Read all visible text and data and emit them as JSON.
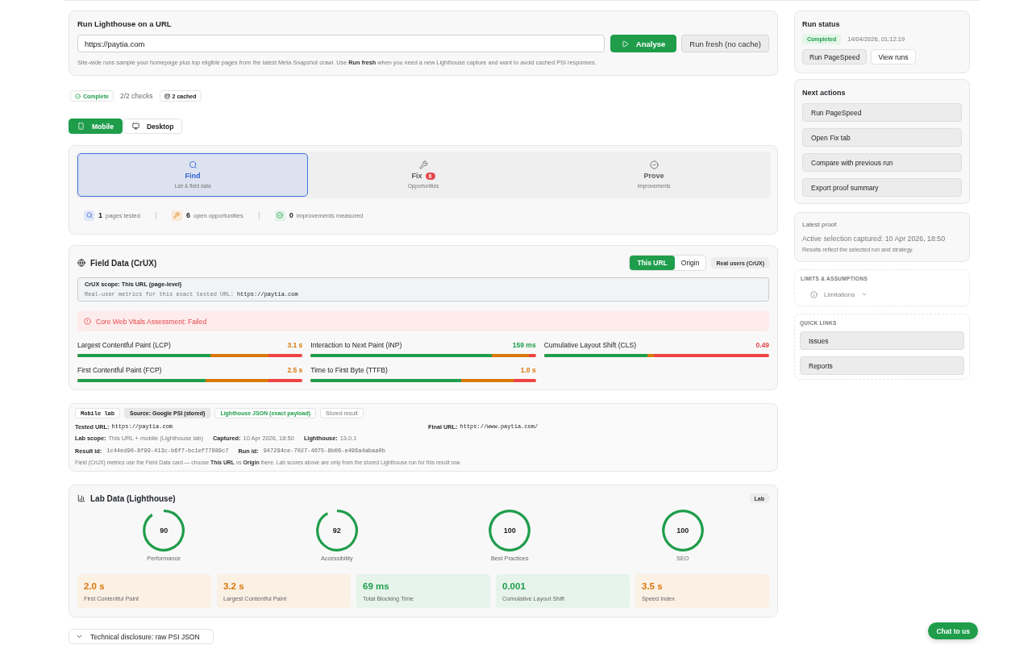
{
  "url_runner": {
    "title": "Run Lighthouse on a URL",
    "url_field": {
      "value": "https://paytia.com"
    },
    "buttons": [
      {
        "label": "Analyse",
        "kind": "primary"
      },
      {
        "label": "Run fresh (no cache)",
        "kind": "secondary"
      }
    ],
    "hint": "Site-wide runs sample your homepage plus top eligible pages from the latest Meta Snapshot crawl. Use **Run fresh** when you need a new Lighthouse capture and want to avoid cached PSI responses."
  },
  "status_chips": [
    {
      "kind": "complete",
      "label": "Complete"
    },
    {
      "kind": "plain",
      "label": "2/2 checks"
    },
    {
      "kind": "cached",
      "label": "2 cached"
    }
  ],
  "strategy_toggle": [
    {
      "label": "Mobile",
      "kind": "mobile",
      "selected": true
    },
    {
      "label": "Desktop",
      "kind": "desktop",
      "selected": false
    }
  ],
  "workflow": {
    "tabs": [
      {
        "kind": "find",
        "label": "Find",
        "sublabel": "Lab & field data",
        "selected": true
      },
      {
        "kind": "fix",
        "label": "Fix",
        "badge": "6",
        "sublabel": "Opportunities",
        "selected": false
      },
      {
        "kind": "prove",
        "label": "Prove",
        "sublabel": "Improvements",
        "selected": false
      }
    ],
    "stats": [
      {
        "kind": "find",
        "count": "1",
        "label": "pages tested"
      },
      {
        "kind": "fix",
        "count": "6",
        "label": "open opportunities"
      },
      {
        "kind": "prove",
        "count": "0",
        "label": "improvements measured"
      }
    ]
  },
  "field_data": {
    "title": "Field Data (CrUX)",
    "scope_toggle": [
      {
        "label": "This URL",
        "selected": true
      },
      {
        "label": "Origin",
        "selected": false
      }
    ],
    "badge": "Real users (CrUX)",
    "scope_note": {
      "title": "CrUX scope: This URL (page-level)",
      "text": "Real-user metrics for this exact tested URL:",
      "url": "https://paytia.com"
    },
    "assessment": "Core Web Vitals Assessment: Failed",
    "metrics": [
      {
        "name": "Largest Contentful Paint (LCP)",
        "value": "3.1 s",
        "color": "#d9780a",
        "fills": [
          {
            "color": "#1f9d4b",
            "level": 0.59
          },
          {
            "color": "#d9780a",
            "level": 0.85
          }
        ]
      },
      {
        "name": "Interaction to Next Paint (INP)",
        "value": "159 ms",
        "color": "#1f9d4b",
        "fills": [
          {
            "color": "#1f9d4b",
            "level": 0.805
          },
          {
            "color": "#d9780a",
            "level": 0.97
          }
        ]
      },
      {
        "name": "Cumulative Layout Shift (CLS)",
        "value": "0.49",
        "color": "#e5484d",
        "fills": [
          {
            "color": "#1f9d4b",
            "level": 0.459
          },
          {
            "color": "#d9780a",
            "level": 0.488
          }
        ]
      },
      {
        "name": "First Contentful Paint (FCP)",
        "value": "2.5 s",
        "color": "#d9780a",
        "fills": [
          {
            "color": "#1f9d4b",
            "level": 0.568
          },
          {
            "color": "#d9780a",
            "level": 0.85
          }
        ]
      },
      {
        "name": "Time to First Byte (TTFB)",
        "value": "1.0 s",
        "color": "#d9780a",
        "fills": [
          {
            "color": "#1f9d4b",
            "level": 0.67
          },
          {
            "color": "#d9780a",
            "level": 0.9
          }
        ]
      }
    ]
  },
  "lab_details": {
    "chips": [
      {
        "kind": "mono",
        "label": "Mobile lab"
      },
      {
        "kind": "filled",
        "label": "Source: Google PSI (stored)"
      },
      {
        "kind": "link",
        "label": "Lighthouse JSON (exact payload)"
      },
      {
        "kind": "muted",
        "label": "Stored result"
      }
    ],
    "rows": [
      {
        "kind": "split",
        "items": [
          {
            "label": "Tested URL:",
            "value": "https://paytia.com",
            "kind": "mono"
          },
          {
            "label": "Final URL:",
            "value": "https://www.paytia.com/",
            "kind": "mono"
          }
        ]
      },
      {
        "kind": "inline",
        "items": [
          {
            "label": "Lab scope:",
            "value": "This URL + mobile (Lighthouse lab)",
            "kind": "text"
          },
          {
            "label": "Captured:",
            "value": "10 Apr 2026, 18:50",
            "kind": "text"
          },
          {
            "label": "Lighthouse:",
            "value": "13.0.1",
            "kind": "text"
          }
        ]
      },
      {
        "kind": "inline",
        "items": [
          {
            "label": "Result id:",
            "value": "1c44ed90-8f99-413c-b6f7-bc1ef77989c7",
            "kind": "id"
          },
          {
            "label": "Run id:",
            "value": "947294ce-7027-4675-8b06-e496a4abaa0b",
            "kind": "id"
          }
        ]
      }
    ],
    "note": "Field (CrUX) metrics use the Field Data card — choose **This URL** vs **Origin** there. Lab scores above are only from the stored Lighthouse run for this result row."
  },
  "lab_data": {
    "title": "Lab Data (Lighthouse)",
    "badge": "Lab",
    "scores": [
      {
        "value": "90",
        "label": "Performance",
        "level": 0.9
      },
      {
        "value": "92",
        "label": "Accessibility",
        "level": 0.92
      },
      {
        "value": "100",
        "label": "Best Practices",
        "level": 1
      },
      {
        "value": "100",
        "label": "SEO",
        "level": 1
      }
    ],
    "metrics": [
      {
        "value": "2.0 s",
        "label": "First Contentful Paint",
        "color": "#d9780a"
      },
      {
        "value": "3.2 s",
        "label": "Largest Contentful Paint",
        "color": "#d9780a"
      },
      {
        "value": "69 ms",
        "label": "Total Blocking Time",
        "color": "#1f9d4b"
      },
      {
        "value": "0.001",
        "label": "Cumulative Layout Shift",
        "color": "#1f9d4b"
      },
      {
        "value": "3.5 s",
        "label": "Speed Index",
        "color": "#d9780a"
      }
    ]
  },
  "disclosure": {
    "label": "Technical disclosure: raw PSI JSON",
    "expanded": false
  },
  "run_status": {
    "title": "Run status",
    "badge": "Completed",
    "timestamp": "14/04/2026, 01:12:19",
    "buttons": [
      {
        "label": "Run PageSpeed",
        "kind": "filled"
      },
      {
        "label": "View runs",
        "kind": "outline"
      }
    ]
  },
  "next_actions": {
    "title": "Next actions",
    "buttons": [
      "Run PageSpeed",
      "Open Fix tab",
      "Compare with previous run",
      "Export proof summary"
    ]
  },
  "latest_proof": {
    "title": "Latest proof",
    "captured": "Active selection captured: 10 Apr 2026, 18:50",
    "note": "Results reflect the selected run and strategy."
  },
  "limits": {
    "heading": "LIMITS & ASSUMPTIONS",
    "toggle": {
      "label": "Limitations",
      "expanded": false
    }
  },
  "quick_links": {
    "heading": "QUICK LINKS",
    "links": [
      "Issues",
      "Reports"
    ]
  },
  "chat_button": {
    "label": "Chat to us"
  }
}
